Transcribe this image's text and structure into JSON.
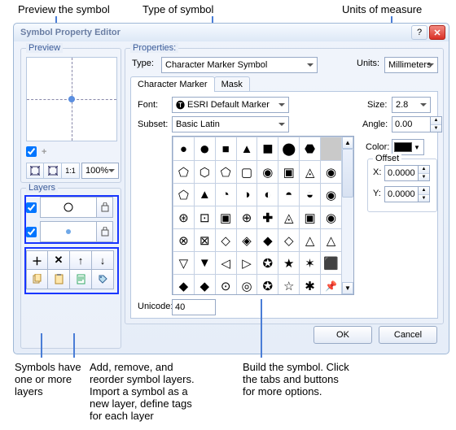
{
  "annotations": {
    "preview": "Preview the symbol",
    "type": "Type of symbol",
    "units": "Units of measure",
    "layers_note": "Symbols have\none or more\nlayers",
    "layer_tools_note": "Add, remove, and\nreorder symbol layers.\nImport a symbol as a\nnew layer, define tags\nfor each layer",
    "build_note": "Build the symbol. Click\nthe tabs and buttons\nfor more options."
  },
  "titlebar": {
    "title": "Symbol Property Editor",
    "help": "?",
    "close": "✕"
  },
  "preview": {
    "label": "Preview",
    "zoom_value": "100%",
    "zoom_buttons": [
      "zoom-extent",
      "zoom-full",
      "one-to-one"
    ]
  },
  "layers": {
    "label": "Layers"
  },
  "layer_tools": {
    "row1": [
      "＋",
      "✕",
      "↑",
      "↓"
    ],
    "row2": [
      "copy",
      "paste",
      "note",
      "tag"
    ]
  },
  "properties": {
    "label": "Properties:",
    "type_label": "Type:",
    "type_value": "Character Marker Symbol",
    "units_label": "Units:",
    "units_value": "Millimeters",
    "tabs": {
      "character": "Character Marker",
      "mask": "Mask"
    },
    "font_label": "Font:",
    "font_value": "ESRI Default Marker",
    "subset_label": "Subset:",
    "subset_value": "Basic Latin",
    "unicode_label": "Unicode:",
    "unicode_value": "40",
    "size_label": "Size:",
    "size_value": "2.8",
    "angle_label": "Angle:",
    "angle_value": "0.00",
    "color_label": "Color:",
    "color_value": "#000000",
    "offset_label": "Offset",
    "offset_x_label": "X:",
    "offset_x_value": "0.0000",
    "offset_y_label": "Y:",
    "offset_y_value": "0.0000"
  },
  "buttons": {
    "ok": "OK",
    "cancel": "Cancel"
  },
  "chart_data": null
}
